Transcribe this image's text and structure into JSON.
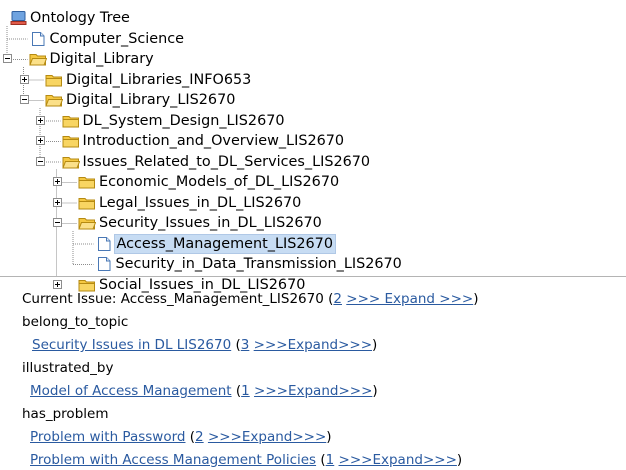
{
  "tree": {
    "rows": [
      {
        "label": "Ontology Tree",
        "icon": "ontology-root-icon",
        "name": "tree-root"
      },
      {
        "label": "Computer_Science",
        "icon": "document-icon",
        "name": "tree-node-computer-science"
      },
      {
        "label": "Digital_Library",
        "icon": "folder-open-icon",
        "toggle": "minus",
        "name": "tree-node-digital-library"
      },
      {
        "label": "Digital_Libraries_INFO653",
        "icon": "folder-closed-icon",
        "toggle": "plus",
        "name": "tree-node-digital-libraries-info653"
      },
      {
        "label": "Digital_Library_LIS2670",
        "icon": "folder-open-icon",
        "toggle": "minus",
        "name": "tree-node-digital-library-lis2670"
      },
      {
        "label": "DL_System_Design_LIS2670",
        "icon": "folder-closed-icon",
        "toggle": "plus",
        "name": "tree-node-dl-system-design"
      },
      {
        "label": "Introduction_and_Overview_LIS2670",
        "icon": "folder-closed-icon",
        "toggle": "plus",
        "name": "tree-node-introduction-and-overview"
      },
      {
        "label": "Issues_Related_to_DL_Services_LIS2670",
        "icon": "folder-open-icon",
        "toggle": "minus",
        "name": "tree-node-issues-related-to-dl-services"
      },
      {
        "label": "Economic_Models_of_DL_LIS2670",
        "icon": "folder-closed-icon",
        "toggle": "plus",
        "name": "tree-node-economic-models"
      },
      {
        "label": "Legal_Issues_in_DL_LIS2670",
        "icon": "folder-closed-icon",
        "toggle": "plus",
        "name": "tree-node-legal-issues"
      },
      {
        "label": "Security_Issues_in_DL_LIS2670",
        "icon": "folder-open-icon",
        "toggle": "minus",
        "name": "tree-node-security-issues"
      },
      {
        "label": "Access_Management_LIS2670",
        "icon": "document-icon",
        "selected": true,
        "name": "tree-node-access-management"
      },
      {
        "label": "Security_in_Data_Transmission_LIS2670",
        "icon": "document-icon",
        "name": "tree-node-security-in-data-transmission"
      },
      {
        "label": "Social_Issues_in_DL_LIS2670",
        "icon": "folder-closed-icon",
        "toggle": "plus",
        "name": "tree-node-social-issues"
      }
    ]
  },
  "info": {
    "current_issue_prefix": "Current Issue: ",
    "current_issue_name": "Access_Management_LIS2670",
    "current_issue_count": "2",
    "current_issue_expand": ">>> Expand >>>",
    "open_paren": " (",
    "close_paren": ")",
    "sections": [
      {
        "heading": "belong_to_topic",
        "items": [
          {
            "link": "Security Issues in DL LIS2670",
            "count": "3",
            "expand": ">>>Expand>>>"
          }
        ]
      },
      {
        "heading": "illustrated_by",
        "items": [
          {
            "link": "Model of Access Management",
            "count": "1",
            "expand": ">>>Expand>>>"
          }
        ]
      },
      {
        "heading": "has_problem",
        "items": [
          {
            "link": "Problem with Password",
            "count": "2",
            "expand": ">>>Expand>>>"
          },
          {
            "link": "Problem with Access Management Policies",
            "count": "1",
            "expand": ">>>Expand>>>"
          }
        ]
      }
    ]
  },
  "colors": {
    "link": "#2a5aa0",
    "selection_bg": "#c7dcf3",
    "folder_fill": "#f5c842",
    "folder_stroke": "#b58a12",
    "document_fill": "#ffffff",
    "document_stroke": "#4a78b5",
    "tree_line": "#8c8c8c"
  }
}
